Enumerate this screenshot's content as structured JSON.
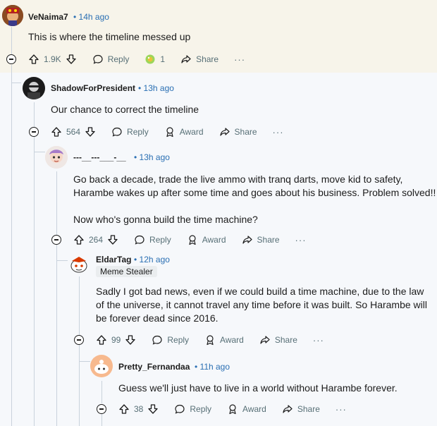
{
  "comments": [
    {
      "user": "VeNaima7",
      "time": "14h ago",
      "text": [
        "This is where the timeline messed up"
      ],
      "score": "1.9K",
      "award_count": "1"
    },
    {
      "user": "ShadowForPresident",
      "time": "13h ago",
      "text": [
        "Our chance to correct the timeline"
      ],
      "score": "564"
    },
    {
      "user": "---__---___-__",
      "time": "13h ago",
      "text": [
        "Go back a decade, trade the live ammo with tranq darts, move kid to safety,",
        "Harambe wakes up after some time and goes about his business. Problem solved!!",
        "",
        "Now who's gonna build the time machine?"
      ],
      "score": "264"
    },
    {
      "user": "EldarTag",
      "time": "12h ago",
      "flair": "Meme Stealer",
      "text": [
        "Sadly I got bad news, even if we could build a time machine, due to the law",
        "of the universe, it cannot travel any time before it was built. So Harambe will",
        "be forever dead since 2016."
      ],
      "score": "99"
    },
    {
      "user": "Pretty_Fernandaa",
      "time": "11h ago",
      "text": [
        "Guess we'll just have to live in a world without Harambe forever."
      ],
      "score": "38"
    }
  ],
  "labels": {
    "reply": "Reply",
    "award": "Award",
    "share": "Share",
    "more": "···",
    "dot": "•"
  },
  "icons": [
    "upvote-icon",
    "downvote-icon",
    "reply-icon",
    "award-icon",
    "share-icon",
    "collapse-icon",
    "award-emoji-icon"
  ],
  "colors": {
    "highlight_bg": "#f7f4ea",
    "page_bg": "#f6f8fb",
    "time_link": "#2a6fb3",
    "muted": "#576f76"
  }
}
